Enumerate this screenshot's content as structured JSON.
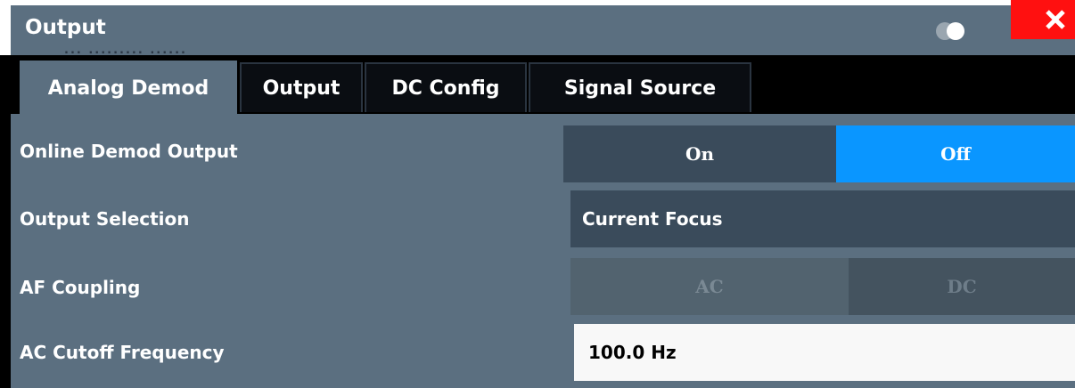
{
  "window": {
    "title": "Output",
    "ghost_text": "... ......... ......",
    "close_symbol": "✕"
  },
  "tabs": [
    {
      "label": "Analog Demod",
      "active": true
    },
    {
      "label": "Output",
      "active": false
    },
    {
      "label": "DC Config",
      "active": false
    },
    {
      "label": "Signal Source",
      "active": false
    }
  ],
  "settings": {
    "online_demod_output": {
      "label": "Online Demod Output",
      "options": [
        "On",
        "Off"
      ],
      "selected": "Off"
    },
    "output_selection": {
      "label": "Output Selection",
      "value": "Current Focus"
    },
    "af_coupling": {
      "label": "AF Coupling",
      "options": [
        "AC",
        "DC"
      ],
      "enabled": false
    },
    "ac_cutoff_frequency": {
      "label": "AC Cutoff Frequency",
      "value": "100.0 Hz"
    }
  },
  "colors": {
    "panel": "#5b6f80",
    "selected": "#0a96ff",
    "close": "#ff1010"
  },
  "icons": {
    "transparency": "transparency-toggle-icon",
    "close": "close-icon"
  }
}
